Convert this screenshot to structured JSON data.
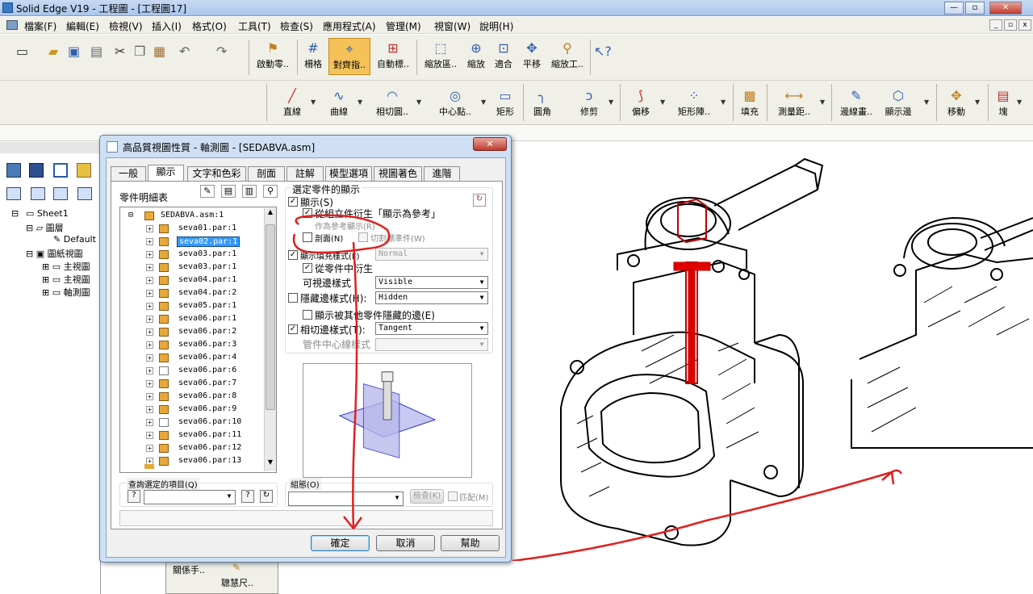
{
  "app": {
    "title": "Solid Edge V19 - 工程圖 - [工程圖17]",
    "window_buttons": [
      "—",
      "▫",
      "✕"
    ]
  },
  "menu": [
    "檔案(F)",
    "編輯(E)",
    "檢視(V)",
    "插入(I)",
    "格式(O)",
    "工具(T)",
    "檢查(S)",
    "應用程式(A)",
    "管理(M)",
    "視窗(W)",
    "說明(H)"
  ],
  "toolbar1": {
    "buttons": [
      "啟動零..",
      "柵格",
      "對齊指..",
      "自動標..",
      "縮放區..",
      "縮放",
      "適合",
      "平移",
      "縮放工.."
    ]
  },
  "toolbar2": {
    "buttons": [
      "直線",
      "曲線",
      "相切圓..",
      "中心點..",
      "矩形",
      "圓角",
      "修剪",
      "偏移",
      "矩形陣..",
      "填充",
      "測量距..",
      "邊線畫..",
      "顯示邊",
      "移動",
      "塊"
    ]
  },
  "left_pane": {
    "tree": [
      "Sheet1",
      "圖層",
      "Default",
      "圖紙視圖",
      "主視圖",
      "主視圖",
      "軸測圖"
    ],
    "bottom_labels": [
      "關係手..",
      "聰慧尺.."
    ]
  },
  "dialog": {
    "title": "高品質視圖性質 - 軸測圖 - [SEDABVA.asm]",
    "close": "✕",
    "tabs": [
      "一般",
      "顯示",
      "文字和色彩",
      "剖面",
      "註解",
      "模型選項",
      "視圖著色",
      "進階"
    ],
    "parts_label": "零件明細表",
    "parts_root": "SEDABVA.asm:1",
    "parts": [
      "seva01.par:1",
      "seva02.par:1",
      "seva03.par:1",
      "seva03.par:1",
      "seva04.par:1",
      "seva04.par:2",
      "seva05.par:1",
      "seva06.par:1",
      "seva06.par:2",
      "seva06.par:3",
      "seva06.par:4",
      "seva06.par:6",
      "seva06.par:7",
      "seva06.par:8",
      "seva06.par:9",
      "seva06.par:10",
      "seva06.par:11",
      "seva06.par:12",
      "seva06.par:13"
    ],
    "selected_part_index": 1,
    "group_title": "選定零件的顯示",
    "display_label": "顯示(S)",
    "derive_assembly": "從組立件衍生「顯示為參考」",
    "show_as_reference": "作為參考顯示(R)",
    "section_label": "剖面(N)",
    "cut_standard_label": "切割標準件(W)",
    "fill_style_label": "顯示填充樣式(F)",
    "fill_style_value": "Normal",
    "derive_from_part": "從零件中衍生",
    "visible_edge_label": "可視邊樣式",
    "visible_edge_value": "Visible",
    "hidden_edge_label": "隱藏邊樣式(H):",
    "hidden_edge_value": "Hidden",
    "show_hidden_by_others": "顯示被其他零件隱藏的邊(E)",
    "tangent_edge_label": "相切邊樣式(T):",
    "tangent_edge_value": "Tangent",
    "tube_centerline_label": "管件中心線樣式",
    "query_label": "查詢選定的項目(Q)",
    "config_label": "組態(O)",
    "check_btn": "檢查(K)",
    "match_label": "匹配(M)",
    "ok": "確定",
    "cancel": "取消",
    "help": "幫助"
  }
}
